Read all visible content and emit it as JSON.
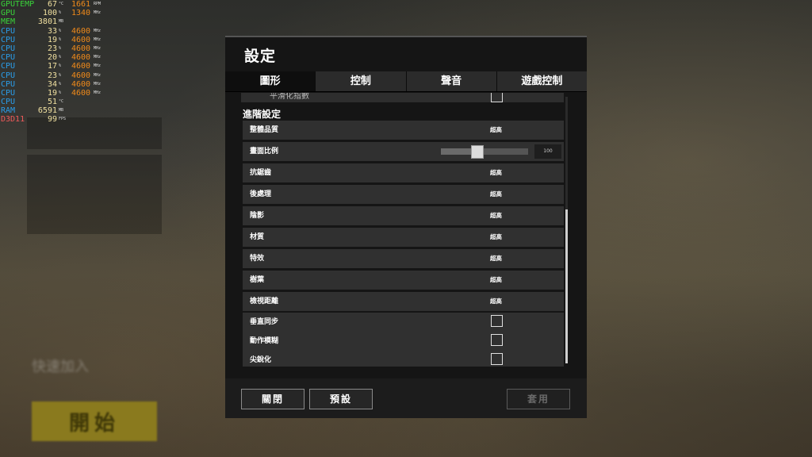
{
  "background": {
    "start_label": "開始",
    "name_label": "快速加入"
  },
  "hud": [
    {
      "label": "GPUTEMP",
      "color": "#39d33a",
      "v1": "67",
      "u1": "°C",
      "v2": "1661",
      "u2": "RPM"
    },
    {
      "label": "GPU",
      "color": "#39d33a",
      "v1": "100",
      "u1": "%",
      "v2": "1340",
      "u2": "MHz"
    },
    {
      "label": "MEM",
      "color": "#39d33a",
      "v1": "3801",
      "u1": "MB",
      "v2": "",
      "u2": ""
    },
    {
      "label": "CPU",
      "color": "#2a9dea",
      "v1": "33",
      "u1": "%",
      "v2": "4600",
      "u2": "MHz"
    },
    {
      "label": "CPU",
      "color": "#2a9dea",
      "v1": "19",
      "u1": "%",
      "v2": "4600",
      "u2": "MHz"
    },
    {
      "label": "CPU",
      "color": "#2a9dea",
      "v1": "23",
      "u1": "%",
      "v2": "4600",
      "u2": "MHz"
    },
    {
      "label": "CPU",
      "color": "#2a9dea",
      "v1": "20",
      "u1": "%",
      "v2": "4600",
      "u2": "MHz"
    },
    {
      "label": "CPU",
      "color": "#2a9dea",
      "v1": "17",
      "u1": "%",
      "v2": "4600",
      "u2": "MHz"
    },
    {
      "label": "CPU",
      "color": "#2a9dea",
      "v1": "23",
      "u1": "%",
      "v2": "4600",
      "u2": "MHz"
    },
    {
      "label": "CPU",
      "color": "#2a9dea",
      "v1": "34",
      "u1": "%",
      "v2": "4600",
      "u2": "MHz"
    },
    {
      "label": "CPU",
      "color": "#2a9dea",
      "v1": "19",
      "u1": "%",
      "v2": "4600",
      "u2": "MHz"
    },
    {
      "label": "CPU",
      "color": "#2a9dea",
      "v1": "51",
      "u1": "°C",
      "v2": "",
      "u2": ""
    },
    {
      "label": "RAM",
      "color": "#2a9dea",
      "v1": "6591",
      "u1": "MB",
      "v2": "",
      "u2": ""
    },
    {
      "label": "D3D11",
      "color": "#f05a5a",
      "v1": "99",
      "u1": "FPS",
      "v2": "",
      "u2": ""
    }
  ],
  "dialog": {
    "title": "設定",
    "tabs": [
      {
        "label": "圖形",
        "active": true
      },
      {
        "label": "控制",
        "active": false
      },
      {
        "label": "聲音",
        "active": false
      },
      {
        "label": "遊戲控制",
        "active": false
      }
    ],
    "partial_label": "平滑化指數",
    "section_title": "進階設定",
    "rows": {
      "overall": {
        "label": "整體品質",
        "value": "超高"
      },
      "screen_scale": {
        "label": "畫面比例",
        "value": "100",
        "slider_fraction": 0.42
      },
      "antialiasing": {
        "label": "抗鋸齒",
        "value": "超高"
      },
      "postprocess": {
        "label": "後處理",
        "value": "超高"
      },
      "shadows": {
        "label": "陰影",
        "value": "超高"
      },
      "textures": {
        "label": "材質",
        "value": "超高"
      },
      "effects": {
        "label": "特效",
        "value": "超高"
      },
      "foliage": {
        "label": "樹葉",
        "value": "超高"
      },
      "view_distance": {
        "label": "檢視距離",
        "value": "超高"
      },
      "vsync": {
        "label": "垂直同步",
        "checked": false
      },
      "motion_blur": {
        "label": "動作模糊",
        "checked": false
      },
      "sharpen": {
        "label": "尖銳化",
        "checked": false
      }
    },
    "buttons": {
      "close": "關閉",
      "default": "預設",
      "apply": "套用"
    }
  }
}
